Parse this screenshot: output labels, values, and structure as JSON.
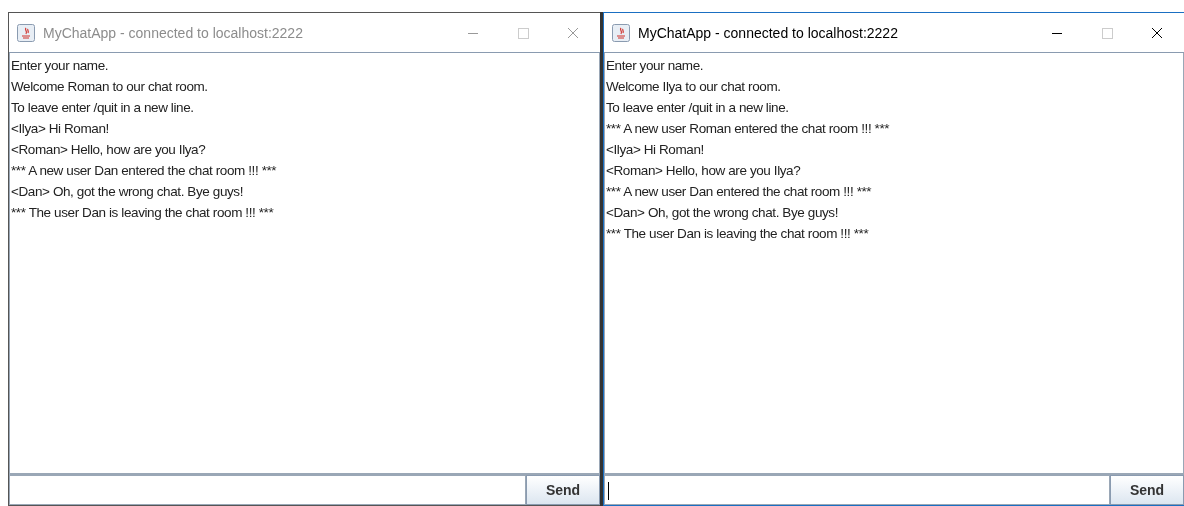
{
  "windows": [
    {
      "title": "MyChatApp - connected to localhost:2222",
      "active": false,
      "lines": [
        "Enter your name.",
        "Welcome Roman to our chat room.",
        "To leave enter /quit in a new line.",
        "<Ilya> Hi Roman!",
        "<Roman> Hello, how are you Ilya?",
        "*** A new user Dan entered the chat room !!! ***",
        "<Dan> Oh, got the wrong chat. Bye guys!",
        "*** The user Dan is leaving the chat room !!! ***"
      ],
      "send": "Send"
    },
    {
      "title": "MyChatApp - connected to localhost:2222",
      "active": true,
      "lines": [
        "Enter your name.",
        "Welcome Ilya to our chat room.",
        "To leave enter /quit in a new line.",
        "*** A new user Roman entered the chat room !!! ***",
        "<Ilya> Hi Roman!",
        "<Roman> Hello, how are you Ilya?",
        "*** A new user Dan entered the chat room !!! ***",
        "<Dan> Oh, got the wrong chat. Bye guys!",
        "*** The user Dan is leaving the chat room !!! ***"
      ],
      "send": "Send"
    }
  ]
}
